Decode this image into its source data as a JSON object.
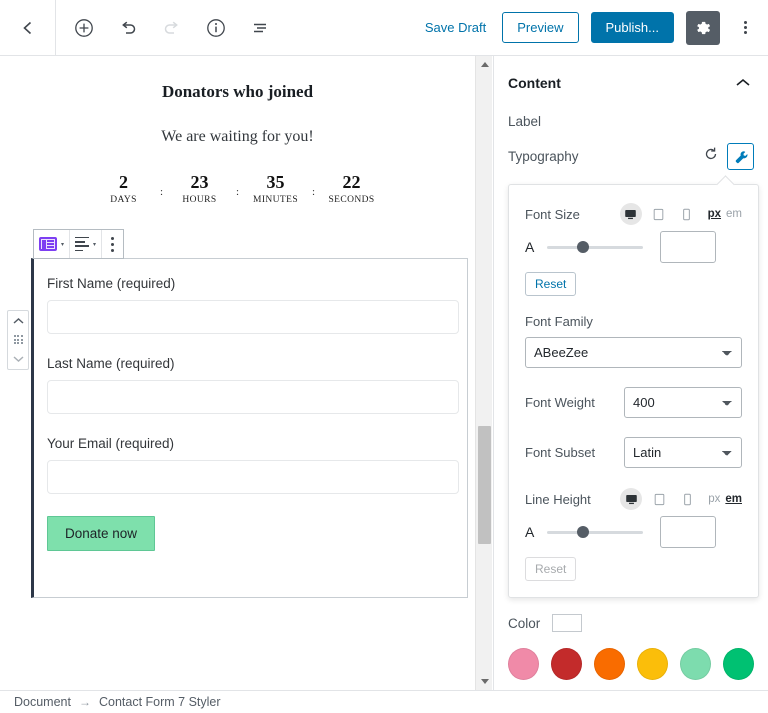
{
  "topbar": {
    "back_icon": "chevron-left-icon",
    "tools": [
      {
        "icon": "add-block-icon",
        "label": "Add block",
        "disabled": false
      },
      {
        "icon": "undo-icon",
        "label": "Undo",
        "disabled": false
      },
      {
        "icon": "redo-icon",
        "label": "Redo",
        "disabled": true
      },
      {
        "icon": "info-icon",
        "label": "Content structure",
        "disabled": false
      },
      {
        "icon": "list-view-icon",
        "label": "Block navigation",
        "disabled": false
      }
    ],
    "save_draft": "Save Draft",
    "preview": "Preview",
    "publish": "Publish...",
    "settings_icon": "gear-icon",
    "more_icon": "kebab-menu-icon",
    "accent_blue": "#0073aa",
    "gear_bg": "#555d66"
  },
  "canvas": {
    "post_title": "Donators who joined",
    "post_subtitle": "We are waiting for you!",
    "countdown": {
      "separator": ":",
      "units": [
        {
          "value": "2",
          "label": "DAYS"
        },
        {
          "value": "23",
          "label": "HOURS"
        },
        {
          "value": "35",
          "label": "MINUTES"
        },
        {
          "value": "22",
          "label": "SECONDS"
        }
      ]
    },
    "block_toolbar": {
      "block_type_icon": "contact-form-icon",
      "align_icon": "align-text-icon",
      "more_icon": "kebab-menu-icon",
      "caret": "▾"
    },
    "block_mover": {
      "up_icon": "chevron-up-icon",
      "drag_icon": "drag-handle-icon",
      "down_icon": "chevron-down-icon"
    },
    "form": {
      "fields": [
        {
          "label": "First Name (required)",
          "value": ""
        },
        {
          "label": "Last Name (required)",
          "value": ""
        },
        {
          "label": "Your Email (required)",
          "value": ""
        }
      ],
      "submit_label": "Donate now",
      "submit_bg": "#7ee0ac",
      "submit_border": "#5fc795"
    },
    "scrollbar": {
      "up_icon": "scroll-up-arrow",
      "down_icon": "scroll-down-arrow"
    }
  },
  "sidebar": {
    "panel_title": "Content",
    "collapse_icon": "chevron-up-icon",
    "label_field": "Label",
    "typography": {
      "name": "Typography",
      "reset_icon": "reset-icon",
      "settings_icon": "wrench-icon"
    },
    "popover": {
      "font_size": {
        "label": "Font Size",
        "devices": [
          {
            "icon": "desktop-icon",
            "active": true
          },
          {
            "icon": "tablet-icon",
            "active": false
          },
          {
            "icon": "mobile-icon",
            "active": false
          }
        ],
        "units": [
          {
            "label": "px",
            "active": true
          },
          {
            "label": "em",
            "active": false
          }
        ],
        "slider_glyph": "A",
        "value": "",
        "reset_label": "Reset",
        "reset_disabled": false
      },
      "font_family": {
        "label": "Font Family",
        "value": "ABeeZee"
      },
      "font_weight": {
        "label": "Font Weight",
        "value": "400"
      },
      "font_subset": {
        "label": "Font Subset",
        "value": "Latin"
      },
      "line_height": {
        "label": "Line Height",
        "devices": [
          {
            "icon": "desktop-icon",
            "active": true
          },
          {
            "icon": "tablet-icon",
            "active": false
          },
          {
            "icon": "mobile-icon",
            "active": false
          }
        ],
        "units": [
          {
            "label": "px",
            "active": false
          },
          {
            "label": "em",
            "active": true
          }
        ],
        "slider_glyph": "A",
        "value": "",
        "reset_label": "Reset",
        "reset_disabled": true
      }
    },
    "color": {
      "label": "Color",
      "current": "",
      "swatches": [
        "#f08aa8",
        "#c32b2b",
        "#f96c00",
        "#fbbe0a",
        "#7ddcae",
        "#00c172"
      ]
    }
  },
  "footer": {
    "breadcrumb": [
      {
        "label": "Document"
      },
      {
        "label": "Contact Form 7 Styler"
      }
    ],
    "separator": "→"
  }
}
